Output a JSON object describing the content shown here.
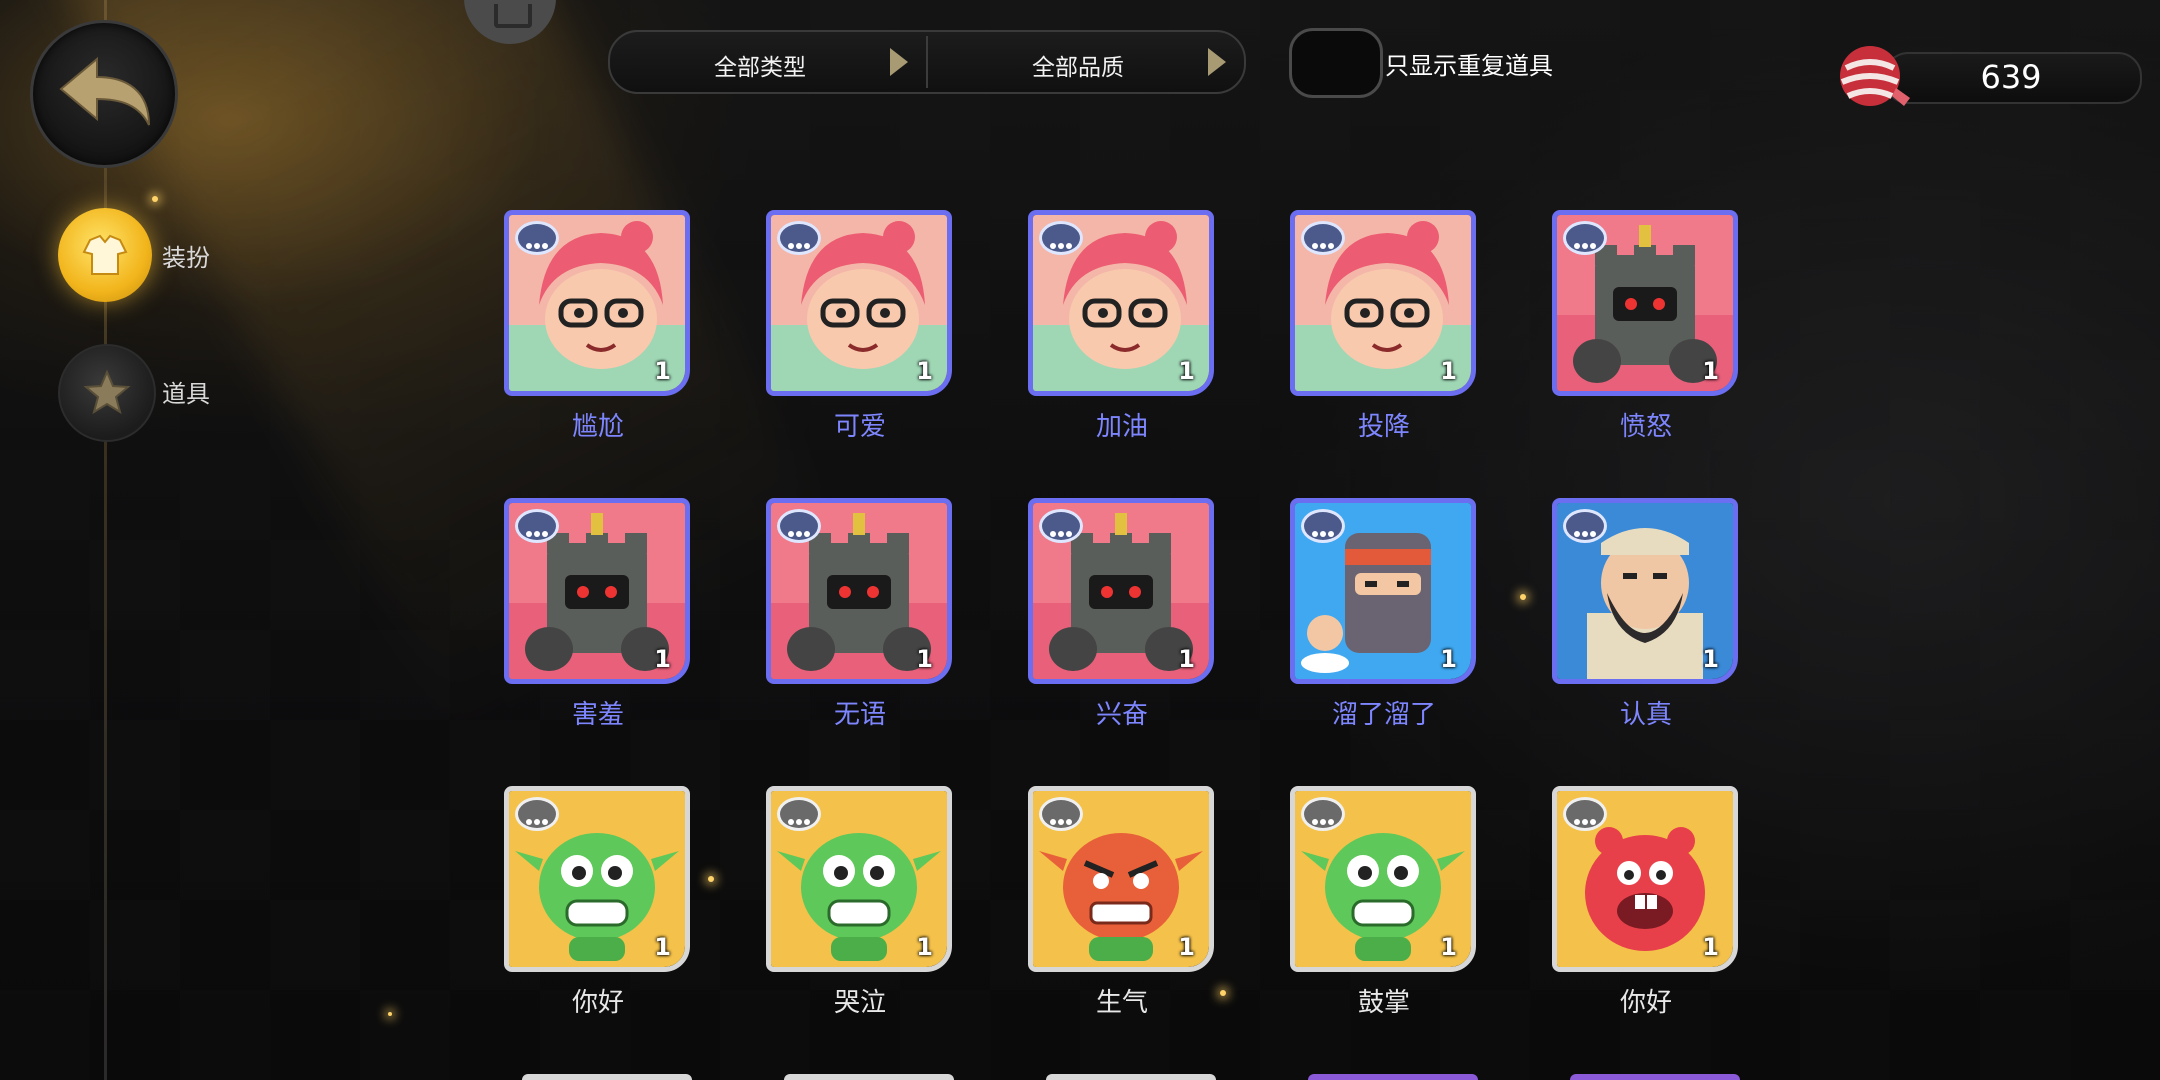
{
  "filters": {
    "type_label": "全部类型",
    "quality_label": "全部品质"
  },
  "toggle": {
    "label": "只显示重复道具",
    "on": false
  },
  "currency": {
    "amount": "639",
    "icon": "candy-icon"
  },
  "sidebar": {
    "items": [
      {
        "label": "装扮",
        "icon": "shirt-icon",
        "active": true
      },
      {
        "label": "道具",
        "icon": "emote-star-icon",
        "active": false
      }
    ]
  },
  "colors": {
    "epic_name": "#7e86ff",
    "epic_frame": "#6b6ef0",
    "common_name": "#e8e8e8",
    "common_frame": "#d7d7d7",
    "active_nav": "#f2b51c"
  },
  "items": [
    {
      "name": "尴尬",
      "count": "1",
      "rarity": "epic",
      "character": "pink-hair-girl"
    },
    {
      "name": "可爱",
      "count": "1",
      "rarity": "epic",
      "character": "pink-hair-girl"
    },
    {
      "name": "加油",
      "count": "1",
      "rarity": "epic",
      "character": "pink-hair-girl"
    },
    {
      "name": "投降",
      "count": "1",
      "rarity": "epic",
      "character": "pink-hair-girl"
    },
    {
      "name": "愤怒",
      "count": "1",
      "rarity": "epic",
      "character": "rook-knight"
    },
    {
      "name": "害羞",
      "count": "1",
      "rarity": "epic",
      "character": "rook-knight"
    },
    {
      "name": "无语",
      "count": "1",
      "rarity": "epic",
      "character": "rook-knight"
    },
    {
      "name": "兴奋",
      "count": "1",
      "rarity": "epic",
      "character": "rook-knight"
    },
    {
      "name": "溜了溜了",
      "count": "1",
      "rarity": "epic",
      "character": "ninja"
    },
    {
      "name": "认真",
      "count": "1",
      "rarity": "epic",
      "character": "bearded-man"
    },
    {
      "name": "你好",
      "count": "1",
      "rarity": "common",
      "character": "green-goblin"
    },
    {
      "name": "哭泣",
      "count": "1",
      "rarity": "common",
      "character": "green-goblin"
    },
    {
      "name": "生气",
      "count": "1",
      "rarity": "common",
      "character": "red-goblin"
    },
    {
      "name": "鼓掌",
      "count": "1",
      "rarity": "common",
      "character": "green-goblin"
    },
    {
      "name": "你好",
      "count": "1",
      "rarity": "common",
      "character": "red-monster"
    }
  ]
}
